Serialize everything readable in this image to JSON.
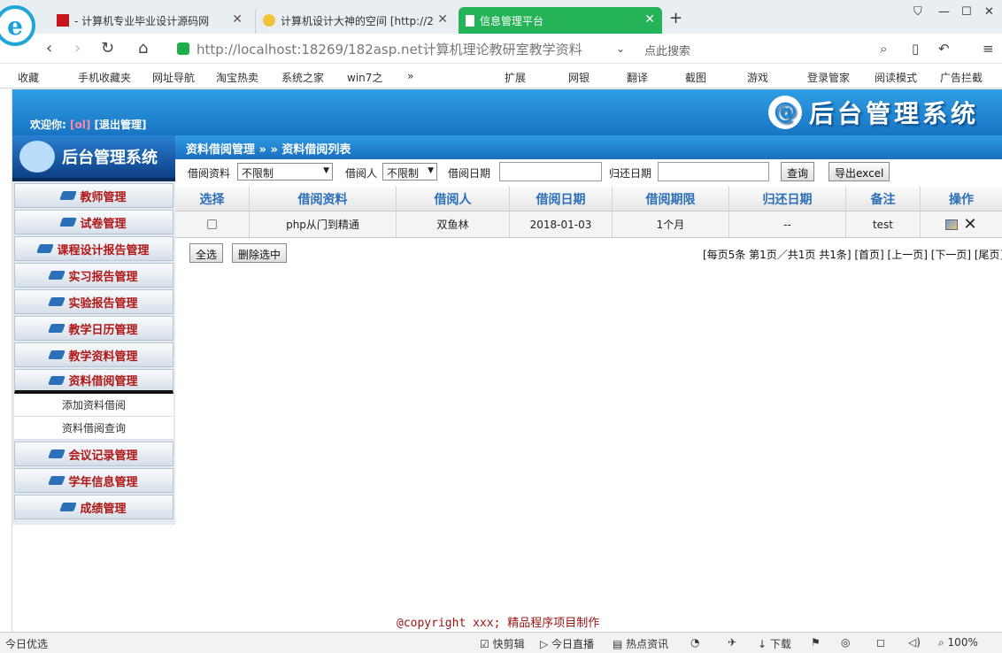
{
  "browser": {
    "tabs": [
      {
        "title": "- 计算机专业毕业设计源码网",
        "active": false
      },
      {
        "title": "计算机设计大神的空间 [http://2",
        "active": false
      },
      {
        "title": "信息管理平台",
        "active": true
      }
    ],
    "new_tab_icon": "+",
    "url": "http://localhost:18269/182asp.net计算机理论教研室教学资料",
    "search_placeholder": "点此搜索",
    "bookmarks": [
      "收藏",
      "手机收藏夹",
      "网址导航",
      "淘宝热卖",
      "系统之家",
      "win7之",
      "»",
      "扩展",
      "网银",
      "翻译",
      "截图",
      "游戏",
      "登录管家",
      "阅读模式",
      "广告拦截"
    ],
    "logo_letter": "e"
  },
  "header": {
    "welcome_label": "欢迎你:",
    "user": "[ol]",
    "logout": "[退出管理]",
    "title": "后台管理系统",
    "at_symbol": "@"
  },
  "sidebar": {
    "title": "后台管理系统",
    "items": [
      {
        "label": "教师管理"
      },
      {
        "label": "试卷管理"
      },
      {
        "label": "课程设计报告管理"
      },
      {
        "label": "实习报告管理"
      },
      {
        "label": "实验报告管理"
      },
      {
        "label": "教学日历管理"
      },
      {
        "label": "教学资料管理"
      },
      {
        "label": "资料借阅管理"
      }
    ],
    "subitems": [
      {
        "label": "添加资料借阅"
      },
      {
        "label": "资料借阅查询"
      }
    ],
    "items_after": [
      {
        "label": "会议记录管理"
      },
      {
        "label": "学年信息管理"
      },
      {
        "label": "成绩管理"
      }
    ]
  },
  "breadcrumb": "资料借阅管理 » » 资料借阅列表",
  "filter": {
    "material_label": "借阅资料",
    "material_value": "不限制",
    "borrower_label": "借阅人",
    "borrower_value": "不限制",
    "borrow_date_label": "借阅日期",
    "return_date_label": "归还日期",
    "query_button": "查询",
    "export_button": "导出excel"
  },
  "table": {
    "columns": [
      "选择",
      "借阅资料",
      "借阅人",
      "借阅日期",
      "借阅期限",
      "归还日期",
      "备注",
      "操作"
    ],
    "rows": [
      {
        "material": "php从门到精通",
        "borrower": "双鱼林",
        "borrow_date": "2018-01-03",
        "period": "1个月",
        "return_date": "--",
        "remark": "test"
      }
    ]
  },
  "actions": {
    "select_all": "全选",
    "delete_selected": "删除选中"
  },
  "pager": {
    "text": "[每页5条 第1页／共1页 共1条] [首页] [上一页] [下一页] [尾页]"
  },
  "footer": {
    "copyright": "@copyright xxx; 精品程序项目制作"
  },
  "statusbar": {
    "left": "今日优选",
    "items": [
      "快剪辑",
      "今日直播",
      "热点资讯",
      "下载"
    ],
    "zoom": "100%"
  },
  "colors": {
    "header_blue": "#1f84d0",
    "active_tab": "#24b356",
    "menu_text": "#b01717",
    "table_header_text": "#2b6fb8"
  }
}
